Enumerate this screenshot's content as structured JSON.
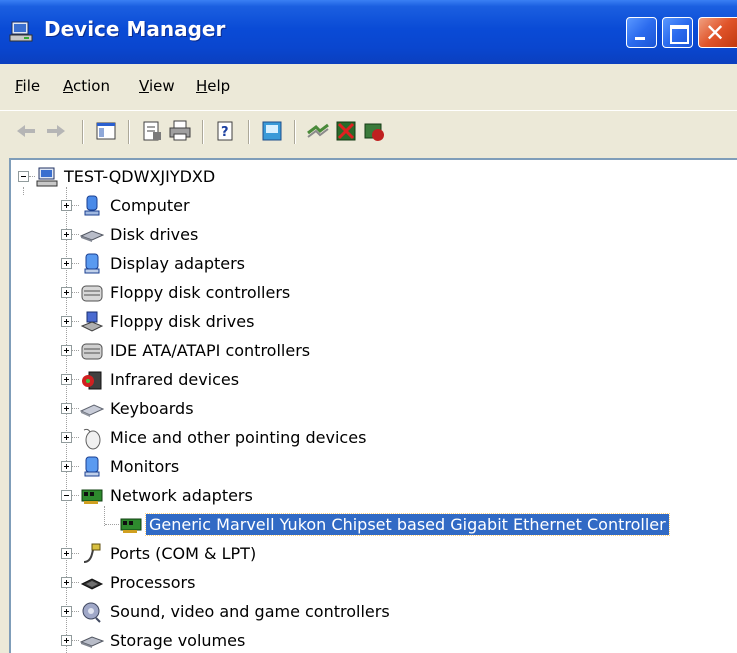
{
  "window": {
    "title": "Device Manager",
    "buttons": {
      "minimize": "minimize-icon",
      "maximize": "maximize-icon",
      "close": "close-icon"
    }
  },
  "menu": {
    "file": "File",
    "action": "Action",
    "view": "View",
    "help": "Help"
  },
  "toolbar": {
    "icons": [
      "back-arrow-icon",
      "forward-arrow-icon",
      "show-hide-console-tree-icon",
      "properties-icon",
      "print-icon",
      "help-icon",
      "scan-hardware-icon",
      "update-driver-icon",
      "uninstall-icon",
      "disable-icon"
    ]
  },
  "tree": {
    "root": {
      "label": "TEST-QDWXJIYDXD",
      "icon": "computer-icon",
      "expanded": true
    },
    "items": [
      {
        "label": "Computer",
        "icon": "computer-icon"
      },
      {
        "label": "Disk drives",
        "icon": "disk-drive-icon"
      },
      {
        "label": "Display adapters",
        "icon": "display-adapter-icon"
      },
      {
        "label": "Floppy disk controllers",
        "icon": "floppy-controller-icon"
      },
      {
        "label": "Floppy disk drives",
        "icon": "floppy-drive-icon"
      },
      {
        "label": "IDE ATA/ATAPI controllers",
        "icon": "ide-controller-icon"
      },
      {
        "label": "Infrared devices",
        "icon": "infrared-icon"
      },
      {
        "label": "Keyboards",
        "icon": "keyboard-icon"
      },
      {
        "label": "Mice and other pointing devices",
        "icon": "mouse-icon"
      },
      {
        "label": "Monitors",
        "icon": "monitor-icon"
      },
      {
        "label": "Network adapters",
        "icon": "network-adapter-icon",
        "expanded": true
      },
      {
        "label": "Ports (COM & LPT)",
        "icon": "port-icon"
      },
      {
        "label": "Processors",
        "icon": "processor-icon"
      },
      {
        "label": "Sound, video and game controllers",
        "icon": "sound-icon"
      },
      {
        "label": "Storage volumes",
        "icon": "storage-volume-icon"
      }
    ],
    "network_child": {
      "label": "Generic Marvell Yukon Chipset based Gigabit Ethernet Controller",
      "icon": "network-card-icon",
      "selected": true
    }
  },
  "colors": {
    "titlebar": "#0a4bd6",
    "selection": "#316ac5",
    "chrome": "#ece9d8"
  }
}
